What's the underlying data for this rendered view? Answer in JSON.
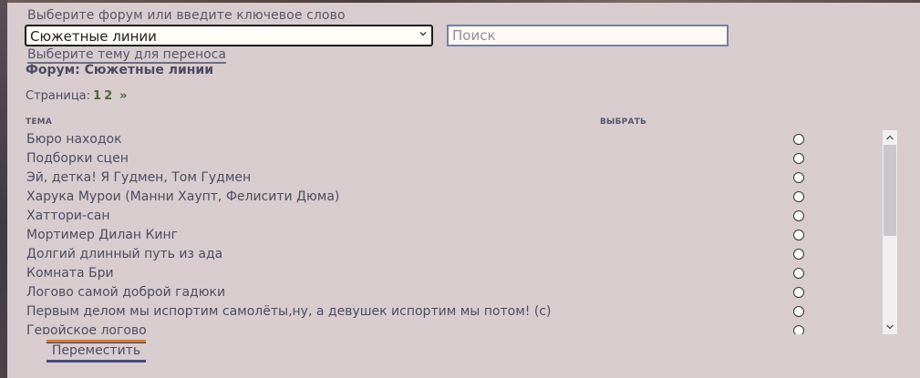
{
  "header": {
    "forum_hint": "Выберите форум или введите ключевое слово",
    "forum_selected": "Сюжетные линии",
    "search_placeholder": "Поиск",
    "topic_hint": "Выберите тему для переноса"
  },
  "forum_title": "Форум: Сюжетные линии",
  "pager": {
    "label": "Страница:",
    "pages": [
      "1",
      "2"
    ],
    "next": "»"
  },
  "table": {
    "col_topic": "ТЕМА",
    "col_select": "ВЫБРАТЬ",
    "rows": [
      "Бюро находок",
      "Подборки сцен",
      "Эй, детка! Я Гудмен, Том Гудмен",
      "Харука Мурои (Манни Хаупт, Фелисити Дюма)",
      "Хаттори-сан",
      "Мортимер Дилан Кинг",
      "Долгий длинный путь из ада",
      "Комната Бри",
      "Логово самой доброй гадюки",
      "Первым делом мы испортим самолёты,ну, а девушек испортим мы потом! (с)",
      "Геройское логово"
    ]
  },
  "move_button": "Переместить",
  "icons": {
    "select_chevron": "chevron-down-icon",
    "scroll_up": "arrow-up-icon",
    "scroll_down": "arrow-down-icon"
  }
}
